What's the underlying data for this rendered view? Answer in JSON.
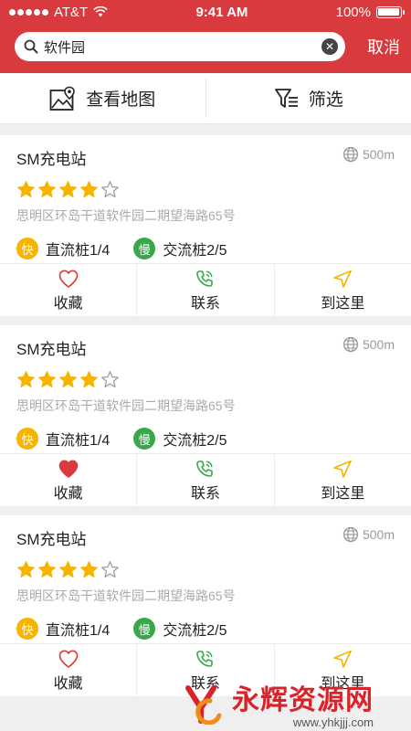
{
  "status_bar": {
    "carrier": "AT&T",
    "time": "9:41 AM",
    "battery": "100%"
  },
  "search": {
    "value": "软件园",
    "cancel_label": "取消"
  },
  "toolbar": {
    "map_label": "查看地图",
    "filter_label": "筛选"
  },
  "stations": [
    {
      "name": "SM充电站",
      "distance": "500m",
      "rating": 4,
      "rating_max": 5,
      "address": "思明区环岛干道软件园二期望海路65号",
      "fast": {
        "badge": "快",
        "label": "直流桩1/4"
      },
      "slow": {
        "badge": "慢",
        "label": "交流桩2/5"
      },
      "favorite": false,
      "actions": {
        "favorite": "收藏",
        "contact": "联系",
        "navigate": "到这里"
      }
    },
    {
      "name": "SM充电站",
      "distance": "500m",
      "rating": 4,
      "rating_max": 5,
      "address": "思明区环岛干道软件园二期望海路65号",
      "fast": {
        "badge": "快",
        "label": "直流桩1/4"
      },
      "slow": {
        "badge": "慢",
        "label": "交流桩2/5"
      },
      "favorite": true,
      "actions": {
        "favorite": "收藏",
        "contact": "联系",
        "navigate": "到这里"
      }
    },
    {
      "name": "SM充电站",
      "distance": "500m",
      "rating": 4,
      "rating_max": 5,
      "address": "思明区环岛干道软件园二期望海路65号",
      "fast": {
        "badge": "快",
        "label": "直流桩1/4"
      },
      "slow": {
        "badge": "慢",
        "label": "交流桩2/5"
      },
      "favorite": false,
      "actions": {
        "favorite": "收藏",
        "contact": "联系",
        "navigate": "到这里"
      }
    }
  ],
  "watermark": {
    "title": "永辉资源网",
    "url": "www.yhkjjj.com"
  },
  "colors": {
    "brand": "#d83a3d",
    "star": "#f5b400",
    "fast": "#f5b400",
    "slow": "#3aa84a",
    "contact": "#3aa84a",
    "navigate": "#f5b400",
    "favorite_on": "#d83a3d"
  }
}
